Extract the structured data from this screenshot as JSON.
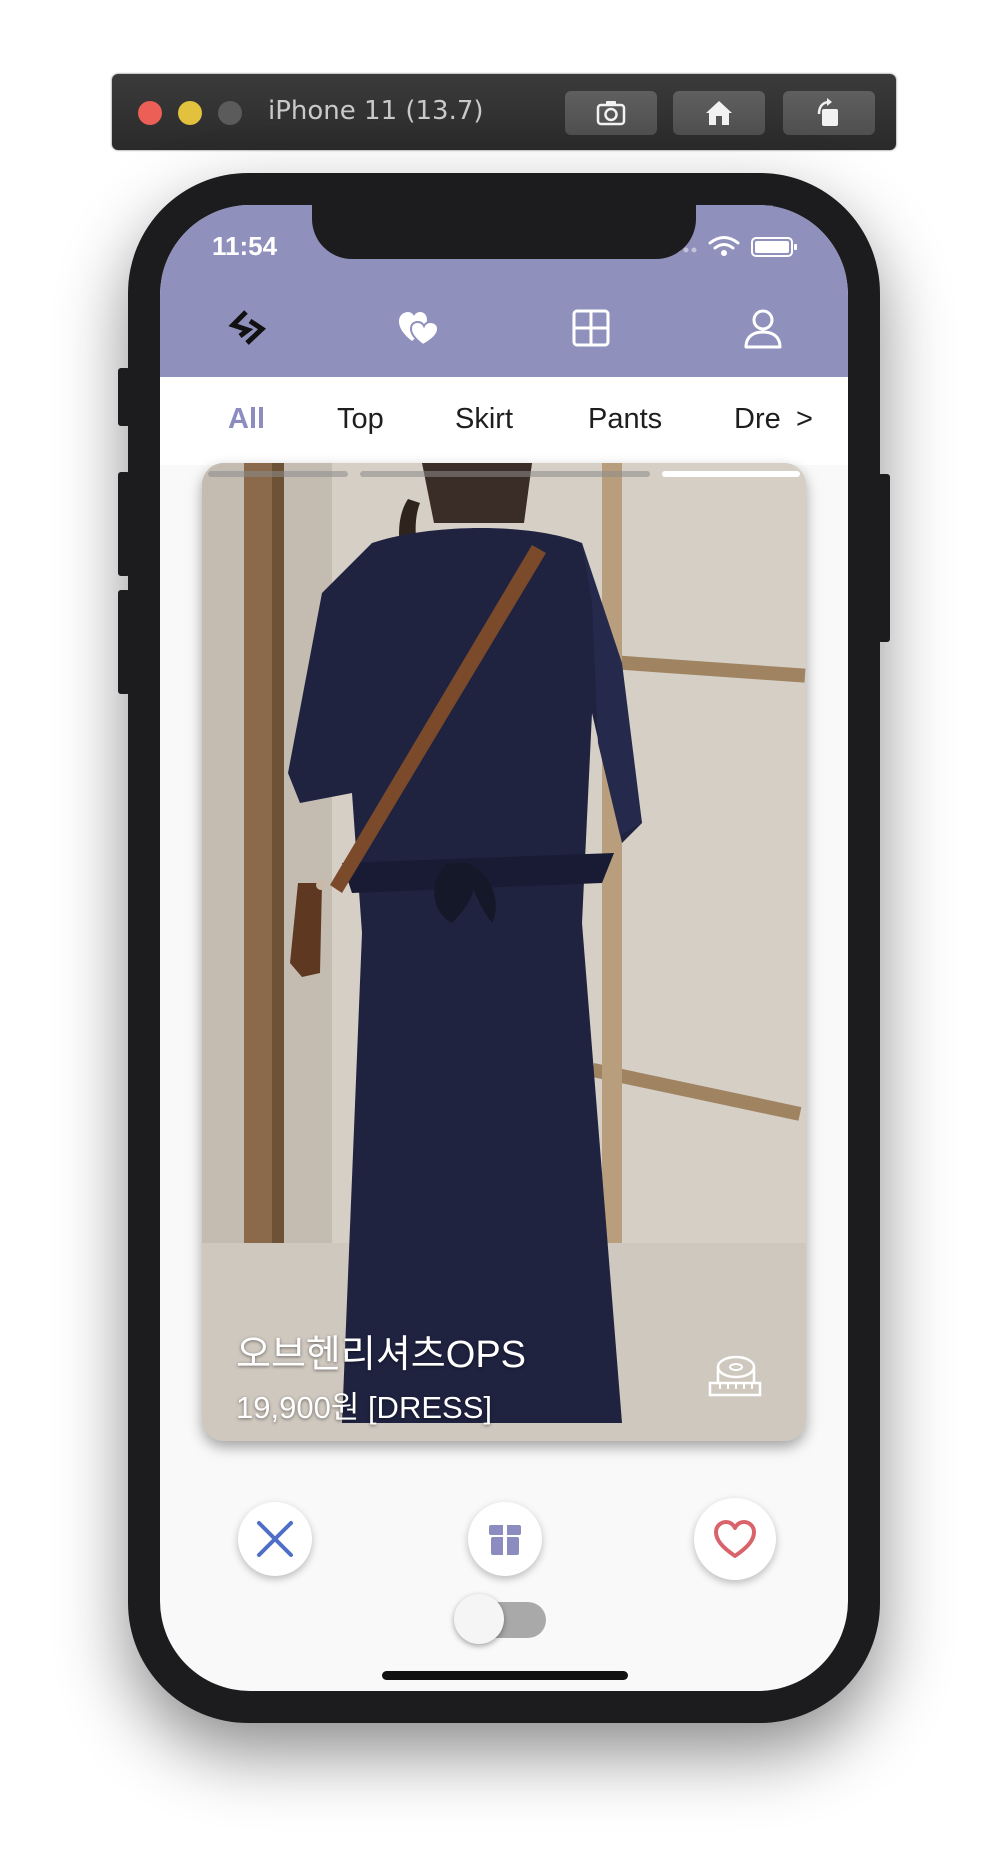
{
  "simulator": {
    "title": "iPhone 11 (13.7)",
    "buttons": [
      "screenshot-icon",
      "home-icon",
      "rotate-icon"
    ]
  },
  "status_bar": {
    "time": "11:54"
  },
  "nav": {
    "icons": [
      "logo-icon",
      "likes-icon",
      "grid-icon",
      "profile-icon"
    ],
    "header_color": "#9090bd"
  },
  "tabs": {
    "items": [
      "All",
      "Top",
      "Skirt",
      "Pants",
      "Dre"
    ],
    "more": ">",
    "active": "All",
    "active_color": "#8c8cc0"
  },
  "card": {
    "name": "오브헨리셔츠OPS",
    "price_line": "19,900원 [DRESS]",
    "image_count": 3,
    "current_image": 3
  },
  "actions": {
    "dislike": "close-icon",
    "gift": "gift-box-icon",
    "like": "heart-icon"
  },
  "toggle": {
    "on": false
  }
}
